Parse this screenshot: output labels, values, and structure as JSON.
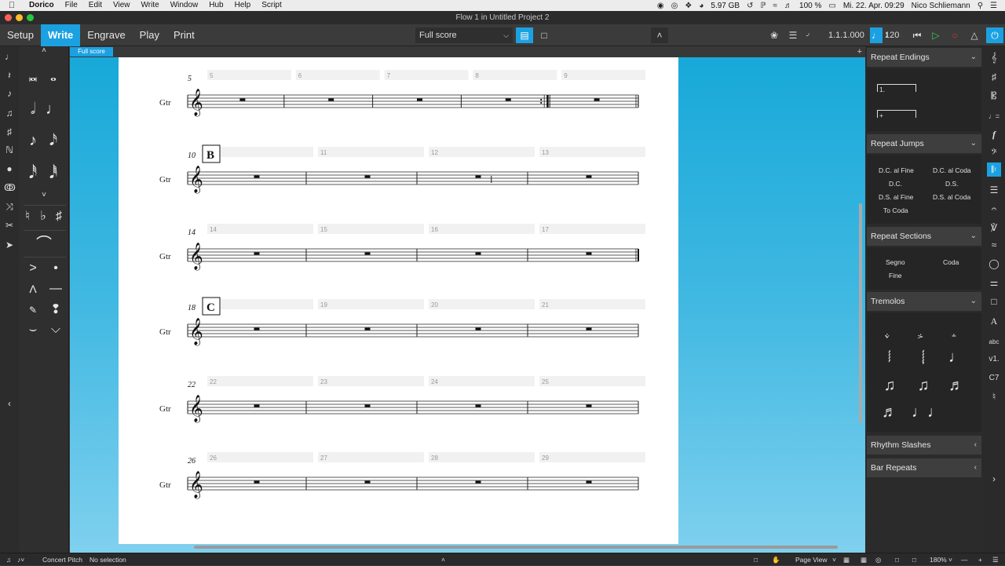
{
  "menubar": {
    "app": "Dorico",
    "items": [
      "File",
      "Edit",
      "View",
      "Write",
      "Window",
      "Hub",
      "Help",
      "Script"
    ],
    "storage": "5.97 GB",
    "battery": "100 %",
    "datetime": "Mi. 22. Apr.  09:29",
    "user": "Nico Schliemann"
  },
  "window": {
    "title": "Flow 1 in Untitled Project 2"
  },
  "toolbar": {
    "modes": [
      "Setup",
      "Write",
      "Engrave",
      "Play",
      "Print"
    ],
    "active_mode": "Write",
    "layout": "Full score",
    "timecode": "1.1.1.000",
    "tempo": "120",
    "accent_color": "#1ba1e2"
  },
  "tabs": {
    "active": "Full score",
    "add": "+"
  },
  "score": {
    "instrument": "Gtr",
    "systems": [
      {
        "start": "5",
        "bars": [
          "5",
          "6",
          "7",
          "8",
          "9"
        ],
        "rehearsal": ""
      },
      {
        "start": "10",
        "bars": [
          "10",
          "11",
          "12",
          "13"
        ],
        "rehearsal": "B"
      },
      {
        "start": "14",
        "bars": [
          "14",
          "15",
          "16",
          "17"
        ],
        "rehearsal": ""
      },
      {
        "start": "18",
        "bars": [
          "18",
          "19",
          "20",
          "21"
        ],
        "rehearsal": "C"
      },
      {
        "start": "22",
        "bars": [
          "22",
          "23",
          "24",
          "25"
        ],
        "rehearsal": ""
      },
      {
        "start": "26",
        "bars": [
          "26",
          "27",
          "28",
          "29"
        ],
        "rehearsal": ""
      }
    ]
  },
  "right_panel": {
    "repeat_endings": {
      "title": "Repeat Endings",
      "items": [
        "1.",
        "+"
      ]
    },
    "repeat_jumps": {
      "title": "Repeat Jumps",
      "items": [
        "D.C. al Fine",
        "D.C. al Coda",
        "D.C.",
        "D.S.",
        "D.S. al Fine",
        "D.S. al Coda",
        "To Coda"
      ]
    },
    "repeat_sections": {
      "title": "Repeat Sections",
      "items": [
        "Segno",
        "Coda",
        "Fine"
      ]
    },
    "tremolos": {
      "title": "Tremolos"
    },
    "rhythm_slashes": {
      "title": "Rhythm Slashes"
    },
    "bar_repeats": {
      "title": "Bar Repeats"
    }
  },
  "statusbar": {
    "concert_pitch": "Concert Pitch",
    "selection": "No selection",
    "view": "Page View",
    "zoom": "180%"
  }
}
